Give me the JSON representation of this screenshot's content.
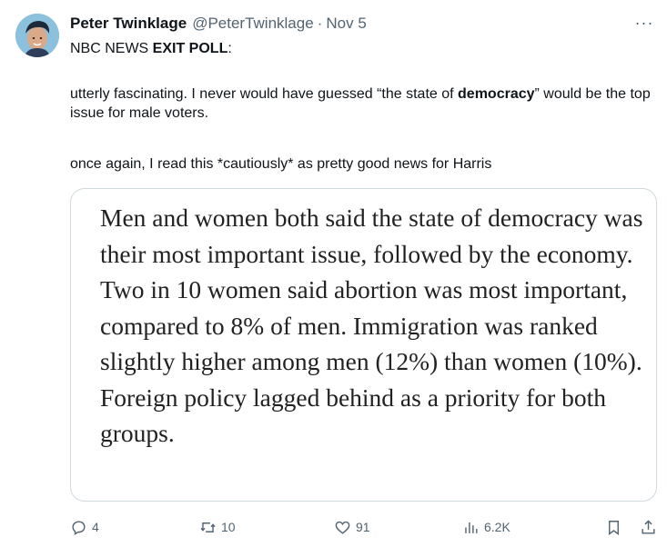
{
  "author": {
    "name": "Peter Twinklage",
    "handle": "@PeterTwinklage",
    "separator": "·",
    "date": "Nov 5"
  },
  "more_label": "···",
  "tweet": {
    "line1_prefix": "NBC NEWS ",
    "line1_bold": "EXIT POLL",
    "line1_suffix": ":",
    "para2_prefix": "utterly fascinating. I never would have guessed “the state of ",
    "para2_bold": "democracy",
    "para2_suffix": "” would be the top issue for male voters.",
    "para3": "once again, I read this *cautiously* as pretty good news for Harris"
  },
  "card": {
    "text": "Men and women both said the state of democracy was their most important issue, followed by the economy. Two in 10 women said abortion was most important, compared to 8% of men. Immigration was ranked slightly higher among men (12%) than women (10%). Foreign policy lagged behind as a priority for both groups."
  },
  "actions": {
    "replies": "4",
    "retweets": "10",
    "likes": "91",
    "views": "6.2K"
  },
  "icons": {
    "reply": "reply-icon",
    "retweet": "retweet-icon",
    "like": "heart-icon",
    "views": "views-icon",
    "bookmark": "bookmark-icon",
    "share": "share-icon"
  },
  "colors": {
    "text": "#0f1419",
    "secondary": "#536471",
    "border": "#cfd9de"
  }
}
